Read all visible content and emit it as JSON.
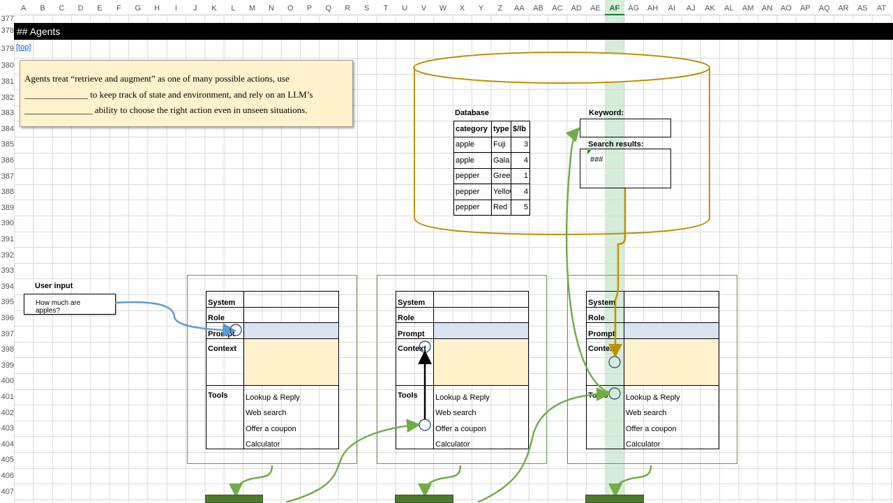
{
  "columns": [
    "A",
    "B",
    "C",
    "D",
    "E",
    "F",
    "G",
    "H",
    "I",
    "J",
    "K",
    "L",
    "M",
    "N",
    "O",
    "P",
    "Q",
    "R",
    "S",
    "T",
    "U",
    "V",
    "W",
    "X",
    "Y",
    "Z",
    "AA",
    "AB",
    "AC",
    "AD",
    "AE",
    "AF",
    "AG",
    "AH",
    "AI",
    "AJ",
    "AK",
    "AL",
    "AM",
    "AN",
    "AO",
    "AP",
    "AQ",
    "AR",
    "AS",
    "AT"
  ],
  "selected_column": "AF",
  "rows": [
    "377",
    "378",
    "379",
    "380",
    "381",
    "382",
    "383",
    "384",
    "385",
    "386",
    "387",
    "388",
    "389",
    "390",
    "391",
    "392",
    "393",
    "394",
    "395",
    "396",
    "397",
    "398",
    "399",
    "400",
    "401",
    "402",
    "403",
    "404",
    "405",
    "406",
    "407"
  ],
  "banner": "## Agents",
  "top_link": "[top]",
  "note": {
    "line1": "Agents treat “retrieve and augment” as one of many possible actions, use",
    "line2": "______________ to keep track of state and environment, and rely on an LLM’s",
    "line3": "_______________ ability to choose the right action even in unseen situations."
  },
  "database": {
    "label": "Database",
    "headers": [
      "category",
      "type",
      "$/lb"
    ],
    "rows": [
      [
        "apple",
        "Fuji",
        "3"
      ],
      [
        "apple",
        "Gala",
        "4"
      ],
      [
        "pepper",
        "Green",
        "1"
      ],
      [
        "pepper",
        "Yellow",
        "4"
      ],
      [
        "pepper",
        "Red",
        "5"
      ]
    ]
  },
  "keyword": {
    "label": "Keyword:",
    "value": ""
  },
  "search": {
    "label": "Search results:",
    "value": "###"
  },
  "user_input": {
    "label": "User input",
    "value": "How much are apples?"
  },
  "panel": {
    "system": "System",
    "role": "Role",
    "prompt": "Prompt",
    "context": "Context",
    "tools": "Tools",
    "tool_items": [
      "Lookup & Reply",
      "Web search",
      "Offer a coupon",
      "Calculator"
    ]
  },
  "colors": {
    "banner": "#000000",
    "note_bg": "#fff2cc",
    "prompt_bg": "#dae3f3",
    "context_bg": "#fff2cc",
    "db_outline": "#bf9000",
    "arrow_green": "#70ad47",
    "arrow_blue": "#5b9bd5",
    "column_highlight": "#d5ecd9"
  }
}
